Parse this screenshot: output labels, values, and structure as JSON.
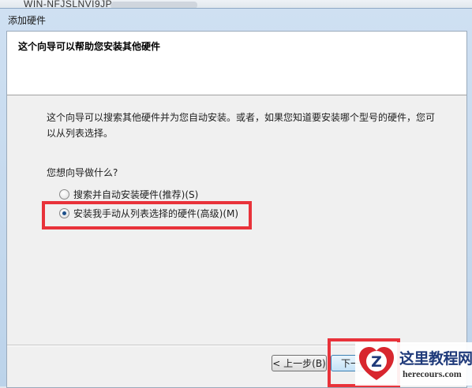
{
  "background_window": {
    "title": "WIN-NFJSLNVI9JP"
  },
  "dialog": {
    "title": "添加硬件",
    "header_title": "这个向导可以帮助您安装其他硬件",
    "description": "这个向导可以搜索其他硬件并为您自动安装。或者，如果您知道要安装哪个型号的硬件，您可以从列表选择。",
    "question": "您想向导做什么?",
    "options": [
      {
        "label": "搜索并自动安装硬件(推荐)(S)",
        "selected": false
      },
      {
        "label": "安装我手动从列表选择的硬件(高级)(M)",
        "selected": true
      }
    ],
    "buttons": {
      "back": "< 上一步(B)",
      "next": "下一步"
    }
  },
  "watermark": {
    "name": "这里教程网",
    "site": "herecours.com"
  },
  "colors": {
    "annotation_red": "#e8323a",
    "radio_dot": "#1d4f8a"
  }
}
